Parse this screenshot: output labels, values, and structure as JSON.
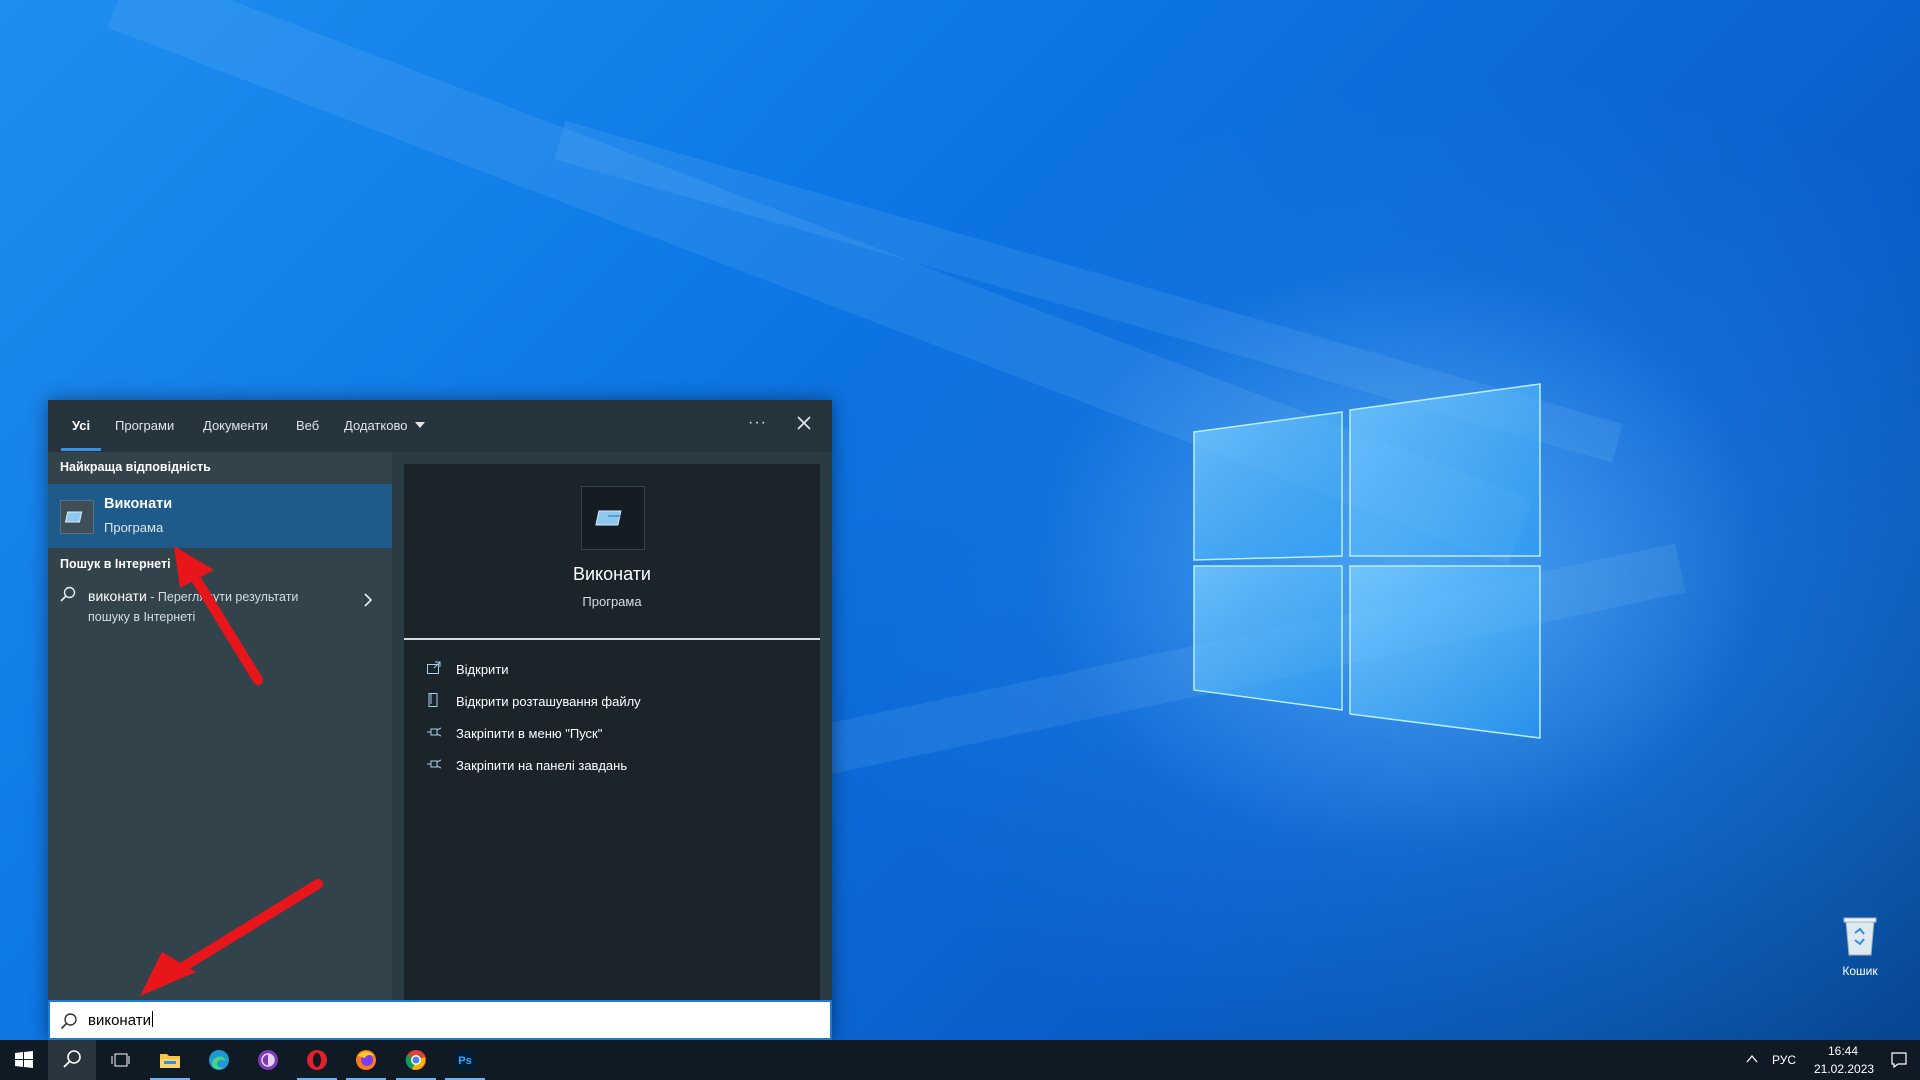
{
  "search_panel": {
    "tabs": [
      {
        "label": "Усі",
        "active": true
      },
      {
        "label": "Програми"
      },
      {
        "label": "Документи"
      },
      {
        "label": "Веб"
      },
      {
        "label": "Додатково"
      }
    ],
    "more_label": "···",
    "best_match_heading": "Найкраща відповідність",
    "best_match": {
      "title": "Виконати",
      "subtitle": "Програма",
      "icon": "run-app-icon"
    },
    "web_heading": "Пошук в Інтернеті",
    "web_result": {
      "query": "виконати",
      "description": " - Переглянути результати пошуку в Інтернеті"
    },
    "detail": {
      "title": "Виконати",
      "subtitle": "Програма",
      "actions": [
        {
          "label": "Відкрити",
          "icon": "open-icon"
        },
        {
          "label": "Відкрити розташування файлу",
          "icon": "file-location-icon"
        },
        {
          "label": "Закріпити в меню \"Пуск\"",
          "icon": "pin-icon"
        },
        {
          "label": "Закріпити на панелі завдань",
          "icon": "pin-icon"
        }
      ]
    },
    "search_value": "виконати"
  },
  "desktop": {
    "recycle_bin_label": "Кошик"
  },
  "taskbar": {
    "apps": [
      "start",
      "search",
      "task-view",
      "file-explorer",
      "edge",
      "tor",
      "opera",
      "firefox",
      "chrome",
      "photoshop"
    ],
    "photoshop_label": "Ps",
    "language": "РУС",
    "time": "16:44",
    "date": "21.02.2023"
  },
  "colors": {
    "accent": "#1e7bd3",
    "selected_row": "#1e5a8a",
    "arrow": "#e8151b"
  }
}
